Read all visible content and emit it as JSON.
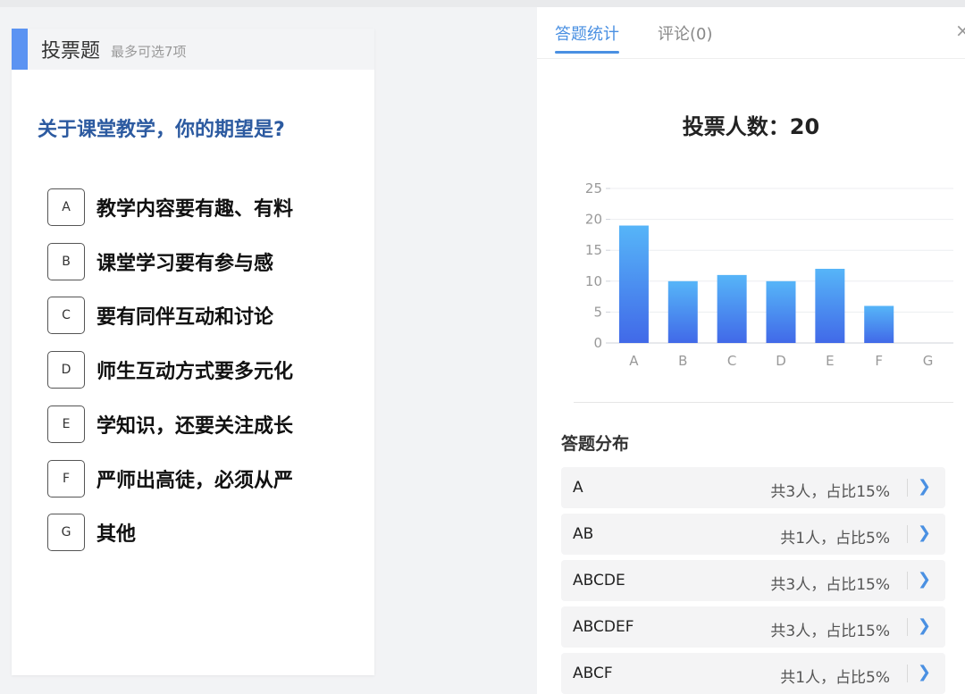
{
  "question": {
    "type": "投票题",
    "hint": "最多可选7项",
    "title": "关于课堂教学，你的期望是?",
    "options": [
      {
        "letter": "A",
        "text": "教学内容要有趣、有料"
      },
      {
        "letter": "B",
        "text": "课堂学习要有参与感"
      },
      {
        "letter": "C",
        "text": "要有同伴互动和讨论"
      },
      {
        "letter": "D",
        "text": "师生互动方式要多元化"
      },
      {
        "letter": "E",
        "text": "学知识，还要关注成长"
      },
      {
        "letter": "F",
        "text": "严师出高徒，必须从严"
      },
      {
        "letter": "G",
        "text": "其他"
      }
    ]
  },
  "panel": {
    "tabs": [
      "答题统计",
      "评论(0)"
    ],
    "voters_label": "投票人数：20",
    "distribution_title": "答题分布",
    "distribution": [
      {
        "combo": "A",
        "stat": "共3人，占比15%"
      },
      {
        "combo": "AB",
        "stat": "共1人，占比5%"
      },
      {
        "combo": "ABCDE",
        "stat": "共3人，占比15%"
      },
      {
        "combo": "ABCDEF",
        "stat": "共3人，占比15%"
      },
      {
        "combo": "ABCF",
        "stat": "共1人，占比5%"
      }
    ]
  },
  "colors": {
    "accent": "#4a90e2",
    "question_title": "#2c5aa0",
    "bar_top": "#56b5f8",
    "bar_bottom": "#4169e8"
  },
  "chart_data": {
    "type": "bar",
    "categories": [
      "A",
      "B",
      "C",
      "D",
      "E",
      "F",
      "G"
    ],
    "values": [
      19,
      10,
      11,
      10,
      12,
      6,
      0
    ],
    "ylim": [
      0,
      25
    ],
    "yticks": [
      0,
      5,
      10,
      15,
      20,
      25
    ],
    "grid": true
  }
}
